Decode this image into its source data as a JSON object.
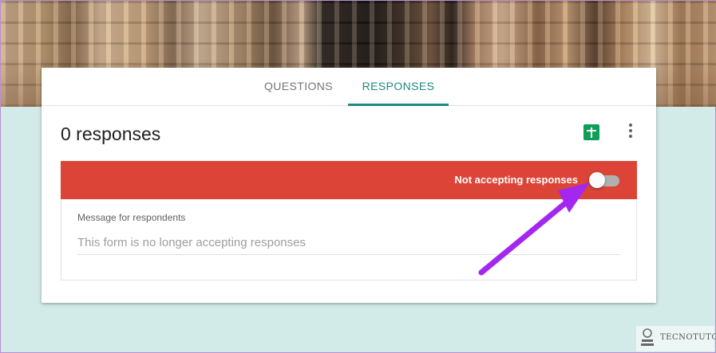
{
  "tabs": [
    {
      "label": "QUESTIONS",
      "active": false
    },
    {
      "label": "RESPONSES",
      "active": true
    }
  ],
  "responses": {
    "count_label": "0 responses",
    "accepting_label": "Not accepting responses",
    "accepting_enabled": false,
    "message_label": "Message for respondents",
    "message_placeholder": "This form is no longer accepting responses"
  },
  "icons": {
    "spreadsheet": "google-sheets-icon",
    "more": "more-vert-icon"
  },
  "colors": {
    "accent": "#1e8a7d",
    "banner_red": "#db4437",
    "sheets_green": "#0f9d58",
    "annotation_arrow": "#a327f0",
    "page_background": "#d3ebe8"
  },
  "watermark": {
    "text": "TECNOTUTO"
  }
}
